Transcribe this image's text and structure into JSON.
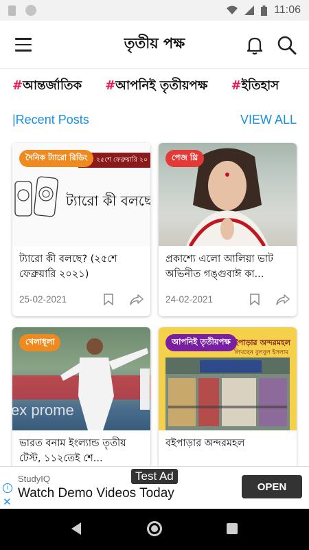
{
  "status": {
    "time": "11:06"
  },
  "app": {
    "title": "তৃতীয় পক্ষ"
  },
  "categories": [
    {
      "hash": "#",
      "label": "আন্তর্জাতিক"
    },
    {
      "hash": "#",
      "label": "আপনিই তৃতীয়পক্ষ"
    },
    {
      "hash": "#",
      "label": "ইতিহাস"
    }
  ],
  "section": {
    "title": "|Recent Posts",
    "view_all": "VIEW ALL"
  },
  "posts": [
    {
      "badge": "দৈনিক ট্যারো রিডিং",
      "badge_color": "#f18a1e",
      "thumb_text": "ট্যারো কী বলছে",
      "thumb_date": "২৫শে ফেব্রুয়ারি ২০",
      "title": "ট্যারো কী বলছে? (২৫শে ফেব্রুয়ারি ২০২১)",
      "date": "25-02-2021"
    },
    {
      "badge": "পেজ থ্রি",
      "badge_color": "#e53935",
      "title": "প্রকাশ্যে এলো আলিয়া ভাট অভিনীত গঙ্গুবাঈ কা...",
      "date": "24-02-2021"
    },
    {
      "badge": "খেলাধূলা",
      "badge_color": "#f18a1e",
      "title": "ভারত বনাম ইংল্যান্ড তৃতীয় টেস্ট, ১১২তেই শে...",
      "date": ""
    },
    {
      "badge": "আপনিই তৃতীয়পক্ষ",
      "badge_color": "#7b1fa2",
      "thumb_text": "বইপাড়ার অন্দরমহল",
      "thumb_sub": "লিখছেন বুলবুল ইসলাম",
      "title": "বইপাড়ার অন্দরমহল",
      "date": ""
    }
  ],
  "ad": {
    "label": "Test Ad",
    "brand": "StudyIQ",
    "text": "Watch Demo Videos Today",
    "button": "OPEN"
  }
}
